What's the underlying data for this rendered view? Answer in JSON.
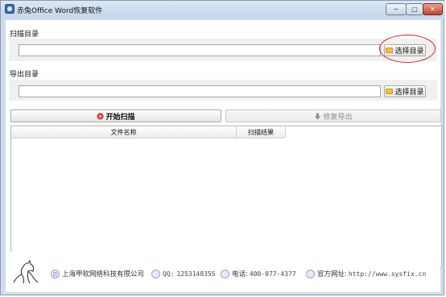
{
  "window": {
    "title": "赤兔Office Word恢复软件",
    "controls": {
      "minimize": "─",
      "maximize": "□",
      "close": "✕"
    }
  },
  "scan_dir": {
    "label": "扫描目录",
    "value": "",
    "button": "选择目录"
  },
  "export_dir": {
    "label": "导出目录",
    "value": "",
    "button": "选择目录"
  },
  "actions": {
    "start_scan": {
      "label": "开始扫描",
      "icon": "play-circle-icon"
    },
    "repair_export": {
      "label": "修复导出",
      "icon": "down-arrow-icon"
    }
  },
  "file_list": {
    "columns": [
      "文件名称",
      "扫描结果"
    ],
    "rows": []
  },
  "footer": {
    "company": "上海甲软网络科技有限公司",
    "qq_label": "QQ:",
    "qq_value": "1253148355",
    "phone_label": "电话:",
    "phone_value": "400-077-4377",
    "website_label": "官方网址:",
    "website_value": "http://www.sysfix.cn"
  },
  "colors": {
    "highlight_circle": "#d0242a",
    "start_icon": "#e23b2c",
    "folder_icon": "#f0c040"
  }
}
